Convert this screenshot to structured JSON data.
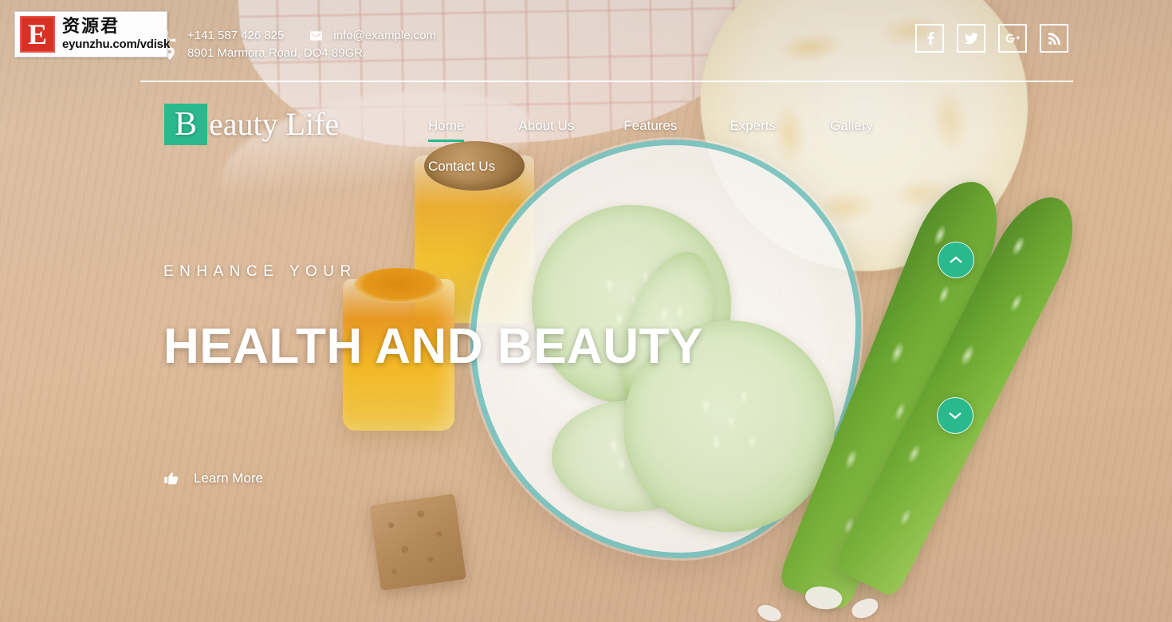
{
  "site": {
    "brand_badge_letter": "B",
    "brand_rest": "eauty Life",
    "accent_color": "#2ab98c"
  },
  "topbar": {
    "phone": "+141 587 426 825",
    "email": "info@example.com",
    "address": "8901 Marmora Road, DO4 89GR.",
    "phone_icon": "phone-icon",
    "email_icon": "envelope-icon",
    "address_icon": "map-pin-icon",
    "social": [
      {
        "name": "facebook",
        "label": "f"
      },
      {
        "name": "twitter",
        "label": "t"
      },
      {
        "name": "google-plus",
        "label": "G+"
      },
      {
        "name": "rss",
        "label": "rss"
      }
    ]
  },
  "nav": {
    "items": [
      {
        "label": "Home",
        "active": true
      },
      {
        "label": "About Us",
        "active": false
      },
      {
        "label": "Features",
        "active": false
      },
      {
        "label": "Experts",
        "active": false
      },
      {
        "label": "Gallery",
        "active": false
      },
      {
        "label": "Contact Us",
        "active": false
      }
    ]
  },
  "hero": {
    "kicker": "ENHANCE YOUR",
    "title": "HEALTH AND BEAUTY",
    "cta_label": "Learn More",
    "cta_icon": "pointing-hand-icon"
  },
  "slider": {
    "prev_icon": "chevron-up-icon",
    "next_icon": "chevron-down-icon"
  },
  "watermark": {
    "letter": "E",
    "cn_text": "资源君",
    "url": "eyunzhu.com/vdisk"
  }
}
